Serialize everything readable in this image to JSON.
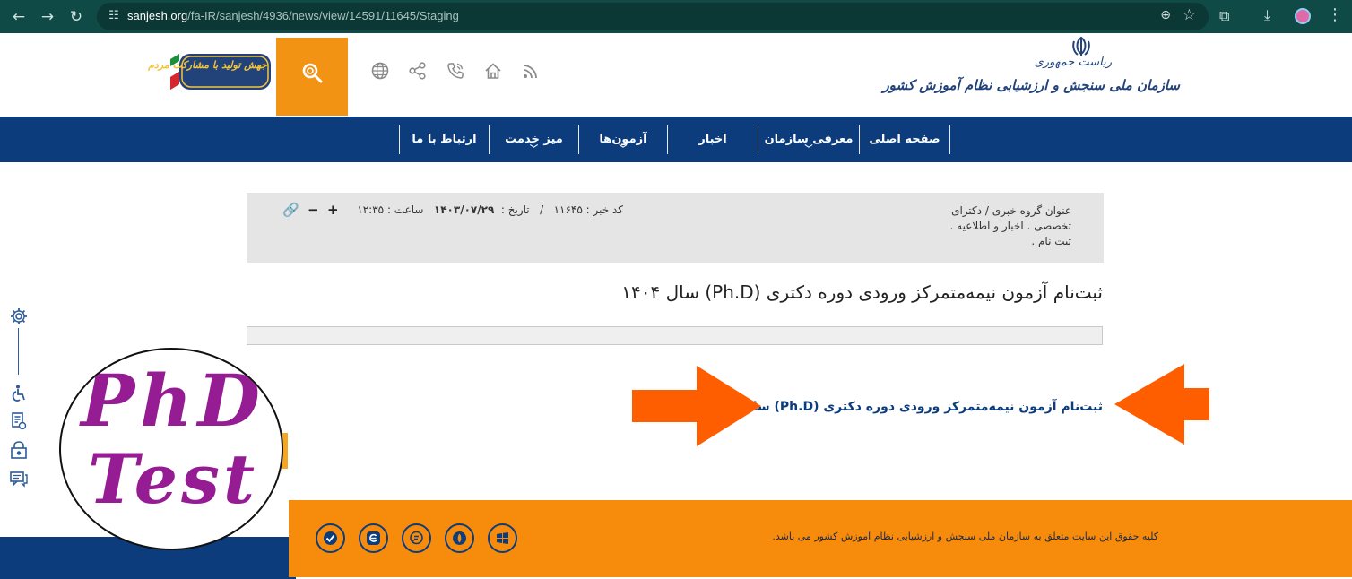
{
  "browser": {
    "url_prefix": "sanjesh.org",
    "url_rest": "/fa-IR/sanjesh/4936/news/view/14591/11645/Staging",
    "back_icon": "arrow-left-icon",
    "forward_icon": "arrow-right-icon",
    "reload_icon": "reload-icon"
  },
  "header": {
    "logo_top": "ریاست جمهوری",
    "logo_main": "سازمان ملی سنجش و ارزشیابی نظام آموزش کشور",
    "badge_text": "جهش تولید با مشارکت مردم",
    "icons": [
      "globe-icon",
      "share-icon",
      "phone-icon",
      "home-icon",
      "rss-icon"
    ],
    "search_color": "#f39313"
  },
  "nav": {
    "items": [
      {
        "label": "صفحه اصلی",
        "dropdown": false
      },
      {
        "label": "معرفی سازمان",
        "dropdown": true
      },
      {
        "label": "اخبار",
        "dropdown": false
      },
      {
        "label": "آزمون‌ها",
        "dropdown": true
      },
      {
        "label": "میز خدمت",
        "dropdown": true
      },
      {
        "label": "ارتباط با ما",
        "dropdown": false
      }
    ],
    "bg_color": "#0d3c7d"
  },
  "meta": {
    "group": "عنوان گروه خبری / دکترای تخصصی . اخبار و اطلاعیه . ثبت نام .",
    "code": "کد خبر : ۱۱۶۴۵",
    "separator": "/",
    "date_label": "تاریخ :",
    "date": "۱۴۰۳/۰۷/۲۹",
    "time_label": "ساعت :",
    "time": "۱۲:۳۵"
  },
  "article": {
    "title": "ثبت‌نام آزمون نیمه‌متمرکز ورودی دوره دکتری (Ph.D) سال ۱۴۰۴",
    "link": "ثبت‌نام آزمون نیمه‌متمرکز ورودی دوره دکتری (Ph.D) سال ۱۴۰۴",
    "arrow_color": "#fe5e00"
  },
  "watermark": {
    "line1": "PhD",
    "line2": "Test",
    "color": "#951c92"
  },
  "footer": {
    "copyright": "کلیه حقوق این سایت متعلق به سازمان ملی سنجش و ارزشیابی نظام آموزش کشور می باشد.",
    "bg_color": "#f78b0b",
    "social": [
      "check-icon",
      "eitaa-icon",
      "chat-icon",
      "rubika-icon",
      "windows-icon"
    ]
  },
  "sidebar_tools": [
    "settings-icon",
    "accessibility-icon",
    "document-icon",
    "lock-icon",
    "comment-icon"
  ]
}
